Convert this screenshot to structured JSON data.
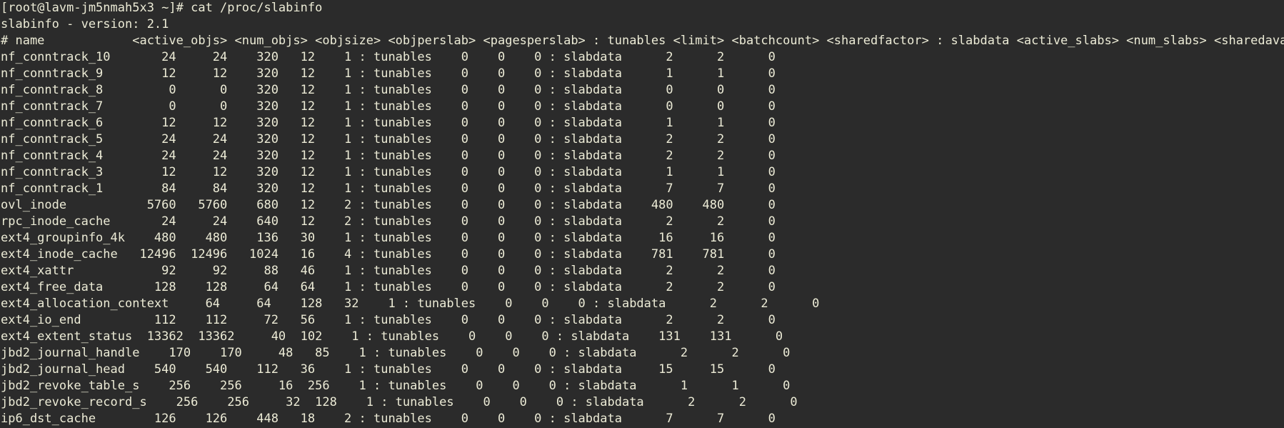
{
  "terminal": {
    "prompt_line": "[root@lavm-jm5nmah5x3 ~]# cat /proc/slabinfo",
    "version_line": "slabinfo - version: 2.1",
    "header_line": "# name            <active_objs> <num_objs> <objsize> <objperslab> <pagesperslab> : tunables <limit> <batchcount> <sharedfactor> : slabdata <active_slabs> <num_slabs> <sharedavail>",
    "rows": [
      "nf_conntrack_10       24     24    320   12    1 : tunables    0    0    0 : slabdata      2      2      0",
      "nf_conntrack_9        12     12    320   12    1 : tunables    0    0    0 : slabdata      1      1      0",
      "nf_conntrack_8         0      0    320   12    1 : tunables    0    0    0 : slabdata      0      0      0",
      "nf_conntrack_7         0      0    320   12    1 : tunables    0    0    0 : slabdata      0      0      0",
      "nf_conntrack_6        12     12    320   12    1 : tunables    0    0    0 : slabdata      1      1      0",
      "nf_conntrack_5        24     24    320   12    1 : tunables    0    0    0 : slabdata      2      2      0",
      "nf_conntrack_4        24     24    320   12    1 : tunables    0    0    0 : slabdata      2      2      0",
      "nf_conntrack_3        12     12    320   12    1 : tunables    0    0    0 : slabdata      1      1      0",
      "nf_conntrack_1        84     84    320   12    1 : tunables    0    0    0 : slabdata      7      7      0",
      "ovl_inode           5760   5760    680   12    2 : tunables    0    0    0 : slabdata    480    480      0",
      "rpc_inode_cache       24     24    640   12    2 : tunables    0    0    0 : slabdata      2      2      0",
      "ext4_groupinfo_4k    480    480    136   30    1 : tunables    0    0    0 : slabdata     16     16      0",
      "ext4_inode_cache   12496  12496   1024   16    4 : tunables    0    0    0 : slabdata    781    781      0",
      "ext4_xattr            92     92     88   46    1 : tunables    0    0    0 : slabdata      2      2      0",
      "ext4_free_data       128    128     64   64    1 : tunables    0    0    0 : slabdata      2      2      0",
      "ext4_allocation_context     64     64    128   32    1 : tunables    0    0    0 : slabdata      2      2      0",
      "ext4_io_end          112    112     72   56    1 : tunables    0    0    0 : slabdata      2      2      0",
      "ext4_extent_status  13362  13362     40  102    1 : tunables    0    0    0 : slabdata    131    131      0",
      "jbd2_journal_handle    170    170     48   85    1 : tunables    0    0    0 : slabdata      2      2      0",
      "jbd2_journal_head    540    540    112   36    1 : tunables    0    0    0 : slabdata     15     15      0",
      "jbd2_revoke_table_s    256    256     16  256    1 : tunables    0    0    0 : slabdata      1      1      0",
      "jbd2_revoke_record_s    256    256     32  128    1 : tunables    0    0    0 : slabdata      2      2      0",
      "ip6_dst_cache        126    126    448   18    2 : tunables    0    0    0 : slabdata      7      7      0"
    ]
  }
}
